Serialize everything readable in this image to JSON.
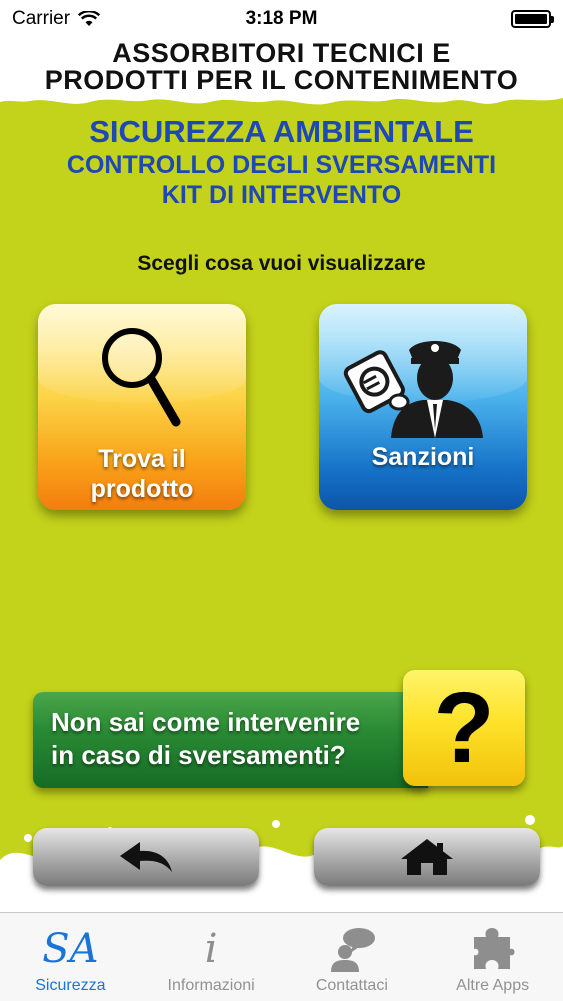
{
  "status_bar": {
    "carrier": "Carrier",
    "time": "3:18 PM"
  },
  "header": {
    "line1": "ASSORBITORI TECNICI E",
    "line2": "PRODOTTI PER IL CONTENIMENTO"
  },
  "titles": {
    "main": "SICUREZZA AMBIENTALE",
    "sub1": "CONTROLLO DEGLI SVERSAMENTI",
    "sub2": "KIT DI INTERVENTO"
  },
  "prompt": "Scegli cosa vuoi visualizzare",
  "buttons": {
    "trova": {
      "line1": "Trova il",
      "line2": "prodotto"
    },
    "sanzioni": {
      "label": "Sanzioni"
    }
  },
  "help": {
    "line1": "Non sai come intervenire",
    "line2": "in caso di sversamenti?",
    "symbol": "?"
  },
  "tabbar": {
    "tabs": [
      {
        "label": "Sicurezza",
        "icon_text": "SA",
        "active": true
      },
      {
        "label": "Informazioni",
        "icon_text": "i",
        "active": false
      },
      {
        "label": "Contattaci",
        "active": false
      },
      {
        "label": "Altre Apps",
        "active": false
      }
    ]
  },
  "colors": {
    "background": "#c3d21a",
    "title_blue": "#1d48b5",
    "tab_active": "#1a73d9"
  }
}
